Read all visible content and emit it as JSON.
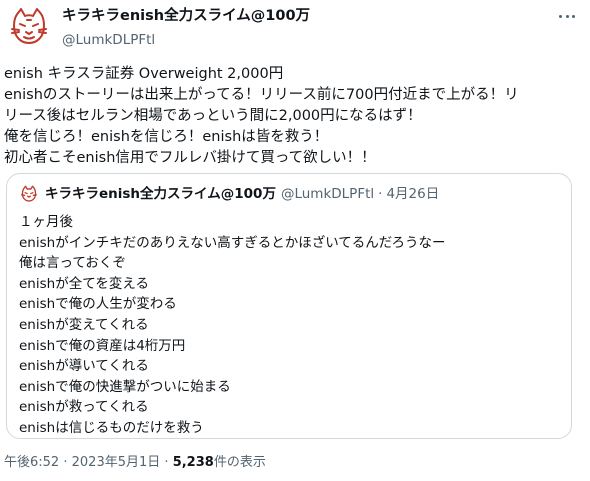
{
  "author": {
    "display_name": "キラキラenish全力スライム@100万",
    "handle": "@LumkDLPFtl"
  },
  "tweet": {
    "lines": [
      "enish キラスラ証券  Overweight 2,000円",
      "enishのストーリーは出来上がってる！リリース前に700円付近まで上がる！リ",
      "リース後はセルラン相場であっという間に2,000円になるはず！",
      "俺を信じろ！enishを信じろ！enishは皆を救う！",
      "初心者こそenish信用でフルレバ掛けて買って欲しい！！"
    ]
  },
  "quote": {
    "display_name": "キラキラenish全力スライム@100万",
    "handle": "@LumkDLPFtl",
    "separator": "·",
    "date": "4月26日",
    "lines": [
      "１ヶ月後",
      "enishがインチキだのありえない高すぎるとかほざいてるんだろうなー",
      "俺は言っておくぞ",
      "enishが全てを変える",
      "enishで俺の人生が変わる",
      "enishが変えてくれる",
      "enishで俺の資産は4桁万円",
      "enishが導いてくれる",
      "enishで俺の快進撃がついに始まる",
      "enishが救ってくれる",
      "enishは信じるものだけを救う"
    ]
  },
  "meta": {
    "time": "午後6:52",
    "separator": "·",
    "date": "2023年5月1日",
    "views_count": "5,238",
    "views_label": "件の表示"
  },
  "icons": {
    "avatar": "cat-face-avatar-icon",
    "more": "more-dots-icon"
  },
  "colors": {
    "text": "#0f1419",
    "secondary": "#536471",
    "border": "#cfd9de",
    "avatar_ink": "#c0392b"
  }
}
